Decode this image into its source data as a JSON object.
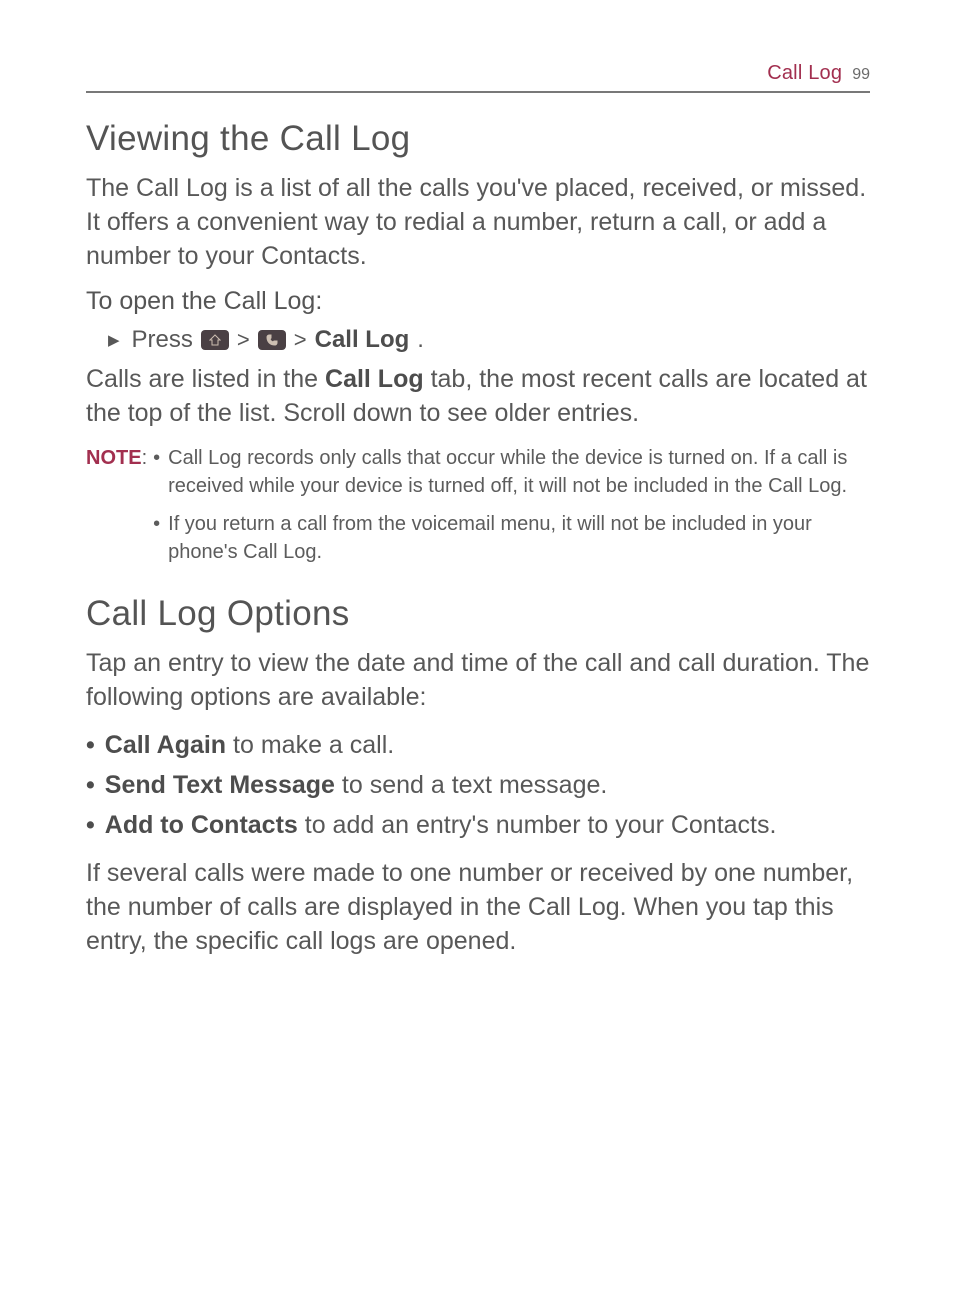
{
  "header": {
    "section": "Call Log",
    "page": "99"
  },
  "h1a": "Viewing the Call Log",
  "intro": "The Call Log is a list of all the calls you've placed, received, or missed. It offers a convenient way to redial a number, return a call, or add a number to your Contacts.",
  "sub_open": "To open the Call Log:",
  "step": {
    "press": "Press",
    "gt": ">",
    "target": "Call Log",
    "period": "."
  },
  "listed_a": "Calls are listed in the ",
  "listed_b": "Call Log",
  "listed_c": " tab, the most recent calls are located at the top of the list. Scroll down to see older entries.",
  "note": {
    "label": "NOTE",
    "colon": ": ",
    "items": [
      "Call Log records only calls that occur while the device is turned on. If a call is received while your device is turned off, it will not be included in the Call Log.",
      "If you return a call from the voicemail menu, it will not be included in your phone's Call Log."
    ]
  },
  "h1b": "Call Log Options",
  "opts_intro": "Tap an entry to view the date and time of the call and call duration. The following options are available:",
  "opts": [
    {
      "bold": "Call Again",
      "rest": " to make a call."
    },
    {
      "bold": "Send Text Message",
      "rest": " to send a text message."
    },
    {
      "bold": "Add to Contacts",
      "rest": " to add an entry's number to your Contacts."
    }
  ],
  "tail": "If several calls were made to one number or received by one number, the number of calls are displayed in the Call Log. When you tap this entry, the specific call logs are opened."
}
